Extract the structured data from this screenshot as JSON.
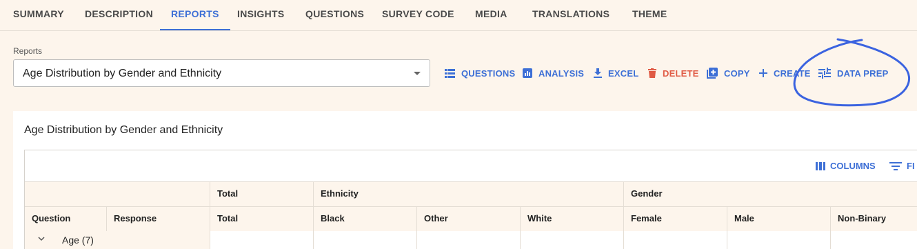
{
  "tabs": [
    {
      "label": "SUMMARY",
      "active": false
    },
    {
      "label": "DESCRIPTION",
      "active": false
    },
    {
      "label": "REPORTS",
      "active": true
    },
    {
      "label": "INSIGHTS",
      "active": false
    },
    {
      "label": "QUESTIONS",
      "active": false
    },
    {
      "label": "SURVEY CODE",
      "active": false
    },
    {
      "label": "MEDIA",
      "active": false
    },
    {
      "label": "TRANSLATIONS",
      "active": false
    },
    {
      "label": "THEME",
      "active": false
    }
  ],
  "reports_select": {
    "label": "Reports",
    "value": "Age Distribution by Gender and Ethnicity"
  },
  "actions": {
    "questions": "QUESTIONS",
    "analysis": "ANALYSIS",
    "excel": "EXCEL",
    "delete": "DELETE",
    "copy": "COPY",
    "create": "CREATE",
    "data_prep": "DATA PREP"
  },
  "colors": {
    "accent": "#3d6fd6",
    "danger": "#e05a44",
    "background": "#fdf5ec",
    "annotation": "#3b63e0"
  },
  "report": {
    "title": "Age Distribution by Gender and Ethnicity",
    "toolbar": {
      "columns": "COLUMNS",
      "filters": "FI"
    },
    "group_headers": {
      "total": "Total",
      "ethnicity": "Ethnicity",
      "gender": "Gender"
    },
    "column_headers": {
      "question": "Question",
      "response": "Response",
      "total": "Total",
      "black": "Black",
      "other": "Other",
      "white": "White",
      "female": "Female",
      "male": "Male",
      "non_binary": "Non-Binary"
    },
    "rows": [
      {
        "question": "Age (7)"
      }
    ]
  }
}
